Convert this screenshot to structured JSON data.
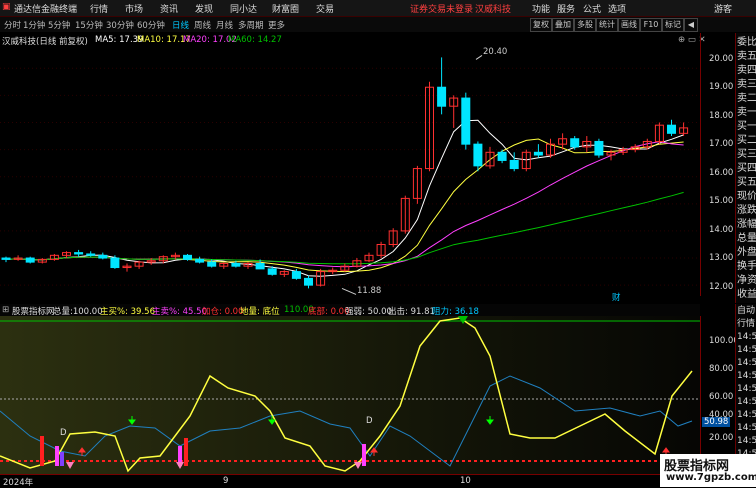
{
  "menu": {
    "app_title": "通达信金融终端",
    "items": [
      "行情",
      "市场",
      "资讯",
      "发现",
      "同小达",
      "财富圈",
      "交易"
    ],
    "notice": "证券交易未登录",
    "stock_name": "汉威科技",
    "right_items": [
      "功能",
      "服务",
      "公式",
      "选项"
    ],
    "guest": "游客"
  },
  "toolbar": {
    "periods": [
      "分时",
      "1分钟",
      "5分钟",
      "15分钟",
      "30分钟",
      "60分钟",
      "日线",
      "周线",
      "月线",
      "多周期",
      "更多"
    ],
    "active_period": "日线",
    "buttons": [
      "复权",
      "叠加",
      "多股",
      "统计",
      "画线",
      "F10",
      "标记",
      "◀"
    ]
  },
  "main_chart": {
    "title": "汉威科技(日线 前复权)",
    "ma5": "MA5: 17.39",
    "ma10": "MA10: 17.17",
    "ma20": "MA20: 17.02",
    "ma60": "MA60: 14.27",
    "high_label": "20.40",
    "low_label": "11.88",
    "fin_marker": "财",
    "y_ticks": [
      "20.00",
      "19.00",
      "18.00",
      "17.00",
      "16.00",
      "15.00",
      "14.00",
      "13.00",
      "12.00"
    ],
    "y_range": [
      11.6,
      21.3
    ],
    "colors": {
      "up": "#ff3030",
      "down": "#00e5ff",
      "ma5": "#ffffff",
      "ma10": "#ffff40",
      "ma20": "#ff40ff",
      "ma60": "#00c000"
    }
  },
  "chart_data": {
    "type": "candlestick",
    "candles": [
      [
        13.0,
        13.05,
        12.85,
        12.95
      ],
      [
        12.95,
        13.1,
        12.9,
        13.0
      ],
      [
        13.0,
        13.05,
        12.8,
        12.85
      ],
      [
        12.85,
        13.0,
        12.8,
        12.95
      ],
      [
        12.95,
        13.15,
        12.9,
        13.1
      ],
      [
        13.1,
        13.25,
        13.0,
        13.2
      ],
      [
        13.2,
        13.3,
        13.05,
        13.15
      ],
      [
        13.15,
        13.25,
        13.05,
        13.1
      ],
      [
        13.1,
        13.2,
        12.95,
        13.0
      ],
      [
        13.0,
        13.1,
        12.6,
        12.65
      ],
      [
        12.65,
        12.8,
        12.5,
        12.7
      ],
      [
        12.7,
        12.9,
        12.6,
        12.85
      ],
      [
        12.85,
        13.0,
        12.75,
        12.9
      ],
      [
        12.9,
        13.1,
        12.8,
        13.05
      ],
      [
        13.05,
        13.2,
        12.95,
        13.1
      ],
      [
        13.1,
        13.15,
        12.9,
        12.95
      ],
      [
        12.95,
        13.05,
        12.8,
        12.85
      ],
      [
        12.85,
        12.95,
        12.65,
        12.7
      ],
      [
        12.7,
        12.85,
        12.6,
        12.8
      ],
      [
        12.8,
        12.9,
        12.65,
        12.7
      ],
      [
        12.7,
        12.85,
        12.6,
        12.8
      ],
      [
        12.8,
        12.95,
        12.7,
        12.6
      ],
      [
        12.6,
        12.7,
        12.35,
        12.4
      ],
      [
        12.4,
        12.55,
        12.3,
        12.5
      ],
      [
        12.5,
        12.6,
        12.2,
        12.25
      ],
      [
        12.25,
        12.35,
        11.88,
        12.0
      ],
      [
        12.0,
        12.6,
        11.95,
        12.5
      ],
      [
        12.5,
        12.65,
        12.4,
        12.55
      ],
      [
        12.55,
        12.8,
        12.5,
        12.7
      ],
      [
        12.7,
        13.0,
        12.65,
        12.9
      ],
      [
        12.9,
        13.2,
        12.85,
        13.1
      ],
      [
        13.1,
        13.6,
        13.0,
        13.5
      ],
      [
        13.5,
        14.1,
        13.4,
        14.0
      ],
      [
        14.0,
        15.3,
        13.9,
        15.2
      ],
      [
        15.2,
        16.4,
        15.0,
        16.3
      ],
      [
        16.3,
        19.5,
        16.2,
        19.3
      ],
      [
        19.3,
        20.4,
        18.3,
        18.6
      ],
      [
        18.6,
        19.0,
        17.8,
        18.9
      ],
      [
        18.9,
        19.1,
        17.0,
        17.2
      ],
      [
        17.2,
        17.3,
        16.2,
        16.4
      ],
      [
        16.4,
        17.1,
        16.3,
        16.9
      ],
      [
        16.9,
        17.0,
        16.5,
        16.6
      ],
      [
        16.6,
        16.9,
        16.2,
        16.3
      ],
      [
        16.3,
        17.0,
        16.2,
        16.9
      ],
      [
        16.9,
        17.2,
        16.7,
        16.8
      ],
      [
        16.8,
        17.4,
        16.7,
        17.2
      ],
      [
        17.2,
        17.6,
        17.0,
        17.4
      ],
      [
        17.4,
        17.5,
        17.0,
        17.1
      ],
      [
        17.1,
        17.5,
        16.9,
        17.3
      ],
      [
        17.3,
        17.4,
        16.7,
        16.8
      ],
      [
        16.8,
        17.0,
        16.6,
        16.9
      ],
      [
        16.9,
        17.1,
        16.8,
        17.0
      ],
      [
        17.0,
        17.2,
        16.9,
        17.1
      ],
      [
        17.1,
        17.4,
        17.0,
        17.3
      ],
      [
        17.3,
        18.0,
        17.2,
        17.9
      ],
      [
        17.9,
        18.1,
        17.5,
        17.6
      ],
      [
        17.6,
        18.0,
        17.5,
        17.8
      ]
    ]
  },
  "indicator": {
    "title": "股票指标网",
    "total": "总量:100.00",
    "main_buy": "主买%: 39.56",
    "main_sell": "主卖%: 45.50",
    "add": "加仓: 0.00",
    "ground": "地量: 底位",
    "bottom_val": "110.00",
    "risk": "底部: 0.00",
    "strong": "强弱: 50.00",
    "exit": "出击: 91.81",
    "resist": "阻力: 36.18",
    "y_ticks": [
      "100.00",
      "80.00",
      "60.00",
      "40.00",
      "20.00"
    ],
    "current_value": "50.98",
    "x_labels": [
      "2024年",
      "9",
      "10"
    ],
    "d_label": "D"
  },
  "right_panel": {
    "top": [
      "委比",
      "卖五",
      "卖四",
      "卖三",
      "卖二",
      "卖一",
      "买一",
      "买二",
      "买三",
      "买四",
      "买五",
      "现价",
      "涨跌",
      "涨幅",
      "总量",
      "外盘",
      "换手",
      "净资",
      "收益"
    ],
    "bottom": [
      "自动",
      "行情",
      "14:5",
      "14:5",
      "14:5",
      "14:5",
      "14:5",
      "14:5",
      "14:5",
      "14:5",
      "14:5",
      "14:5",
      "14:5"
    ]
  },
  "watermark": {
    "line1": "股票指标网",
    "line2": "www.7gpzb.com"
  }
}
